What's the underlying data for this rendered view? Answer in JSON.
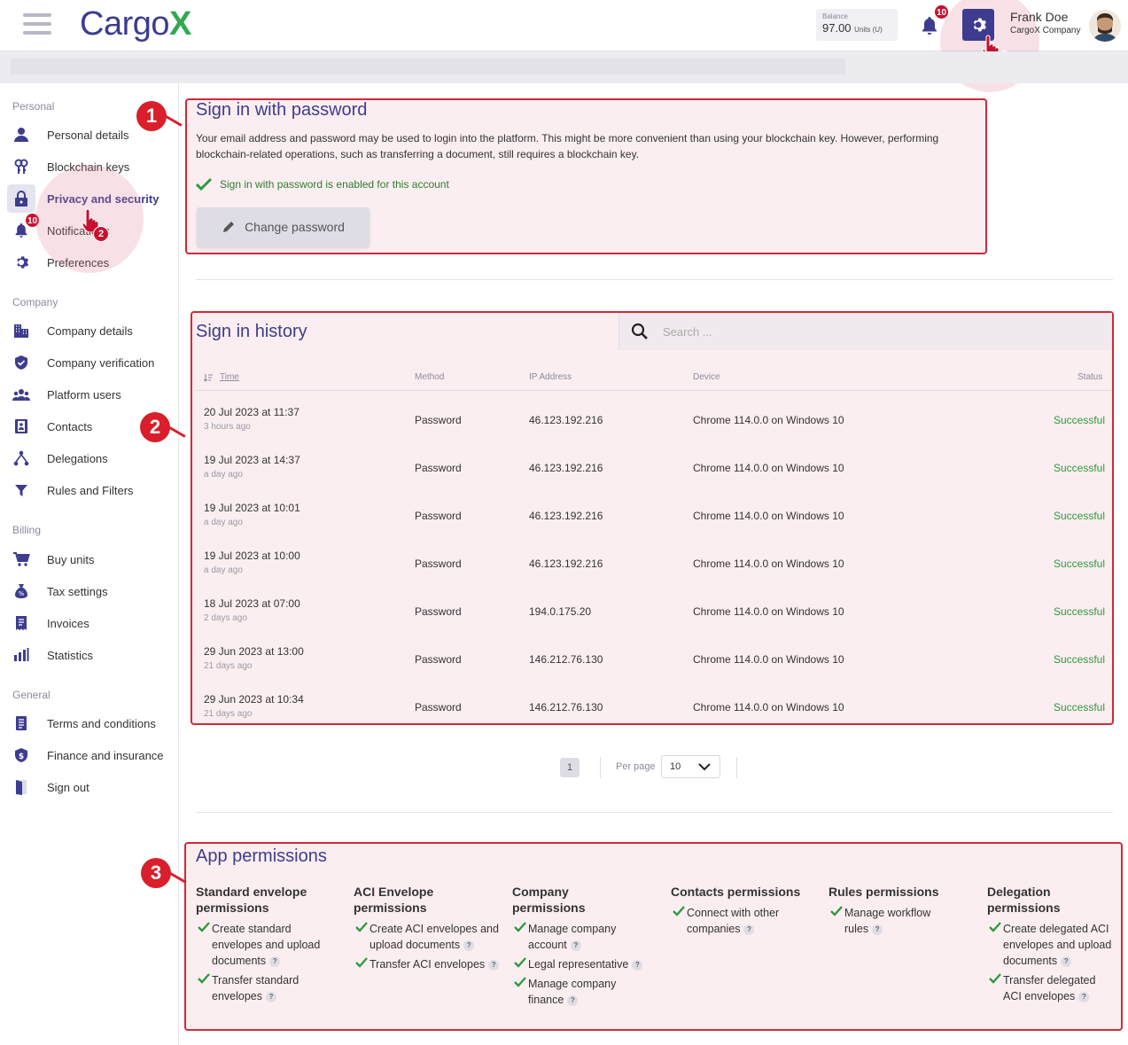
{
  "header": {
    "logo_text": "Cargo",
    "logo_x": "X",
    "balance_label": "Balance",
    "balance_value": "97.00",
    "balance_unit": "Units (U)",
    "notifications_count": "10",
    "user_name": "Frank Doe",
    "user_company": "CargoX Company",
    "callout_number": "1"
  },
  "sidebar": {
    "sections": {
      "personal": "Personal",
      "company": "Company",
      "billing": "Billing",
      "general": "General"
    },
    "items": {
      "personal_details": "Personal details",
      "blockchain_keys": "Blockchain keys",
      "privacy_security": "Privacy and security",
      "notifications": "Notifications",
      "notifications_badge": "10",
      "preferences": "Preferences",
      "company_details": "Company details",
      "company_verification": "Company verification",
      "platform_users": "Platform users",
      "contacts": "Contacts",
      "delegations": "Delegations",
      "rules_filters": "Rules and Filters",
      "buy_units": "Buy units",
      "tax_settings": "Tax settings",
      "invoices": "Invoices",
      "statistics": "Statistics",
      "terms": "Terms and conditions",
      "finance": "Finance and insurance",
      "sign_out": "Sign out"
    },
    "callout_number": "2"
  },
  "signin_password": {
    "title": "Sign in with password",
    "description": "Your email address and password may be used to login into the platform. This might be more convenient than using your blockchain key. However, performing blockchain-related operations, such as transferring a document, still requires a blockchain key.",
    "enabled_text": "Sign in with password is enabled for this account",
    "change_button": "Change password",
    "callout_number": "1"
  },
  "history": {
    "title": "Sign in history",
    "search_placeholder": "Search ...",
    "callout_number": "2",
    "columns": {
      "time": "Time",
      "method": "Method",
      "ip": "IP Address",
      "device": "Device",
      "status": "Status"
    },
    "rows": [
      {
        "time": "20 Jul 2023 at 11:37",
        "ago": "3 hours ago",
        "method": "Password",
        "ip": "46.123.192.216",
        "device": "Chrome 114.0.0 on Windows 10",
        "status": "Successful"
      },
      {
        "time": "19 Jul 2023 at 14:37",
        "ago": "a day ago",
        "method": "Password",
        "ip": "46.123.192.216",
        "device": "Chrome 114.0.0 on Windows 10",
        "status": "Successful"
      },
      {
        "time": "19 Jul 2023 at 10:01",
        "ago": "a day ago",
        "method": "Password",
        "ip": "46.123.192.216",
        "device": "Chrome 114.0.0 on Windows 10",
        "status": "Successful"
      },
      {
        "time": "19 Jul 2023 at 10:00",
        "ago": "a day ago",
        "method": "Password",
        "ip": "46.123.192.216",
        "device": "Chrome 114.0.0 on Windows 10",
        "status": "Successful"
      },
      {
        "time": "18 Jul 2023 at 07:00",
        "ago": "2 days ago",
        "method": "Password",
        "ip": "194.0.175.20",
        "device": "Chrome 114.0.0 on Windows 10",
        "status": "Successful"
      },
      {
        "time": "29 Jun 2023 at 13:00",
        "ago": "21 days ago",
        "method": "Password",
        "ip": "146.212.76.130",
        "device": "Chrome 114.0.0 on Windows 10",
        "status": "Successful"
      },
      {
        "time": "29 Jun 2023 at 10:34",
        "ago": "21 days ago",
        "method": "Password",
        "ip": "146.212.76.130",
        "device": "Chrome 114.0.0 on Windows 10",
        "status": "Successful"
      }
    ],
    "pagination": {
      "current_page": "1",
      "per_page_label": "Per page",
      "per_page_value": "10"
    }
  },
  "permissions": {
    "title": "App permissions",
    "callout_number": "3",
    "help_symbol": "?",
    "columns": [
      {
        "heading": "Standard envelope permissions",
        "items": [
          "Create standard envelopes and upload documents",
          "Transfer standard envelopes"
        ]
      },
      {
        "heading": "ACI Envelope permissions",
        "items": [
          "Create ACI envelopes and upload documents",
          "Transfer ACI envelopes"
        ]
      },
      {
        "heading": "Company permissions",
        "items": [
          "Manage company account",
          "Legal representative",
          "Manage company finance"
        ]
      },
      {
        "heading": "Contacts permissions",
        "items": [
          "Connect with other companies"
        ]
      },
      {
        "heading": "Rules permissions",
        "items": [
          "Manage workflow rules"
        ]
      },
      {
        "heading": "Delegation permissions",
        "items": [
          "Create delegated ACI envelopes and upload documents",
          "Transfer delegated ACI envelopes"
        ]
      }
    ]
  },
  "colors": {
    "brand": "#3d3c8f",
    "accent_green": "#33a853",
    "success": "#2e9a3d",
    "highlight_red": "#d02a3a",
    "badge_red": "#c8102e"
  }
}
